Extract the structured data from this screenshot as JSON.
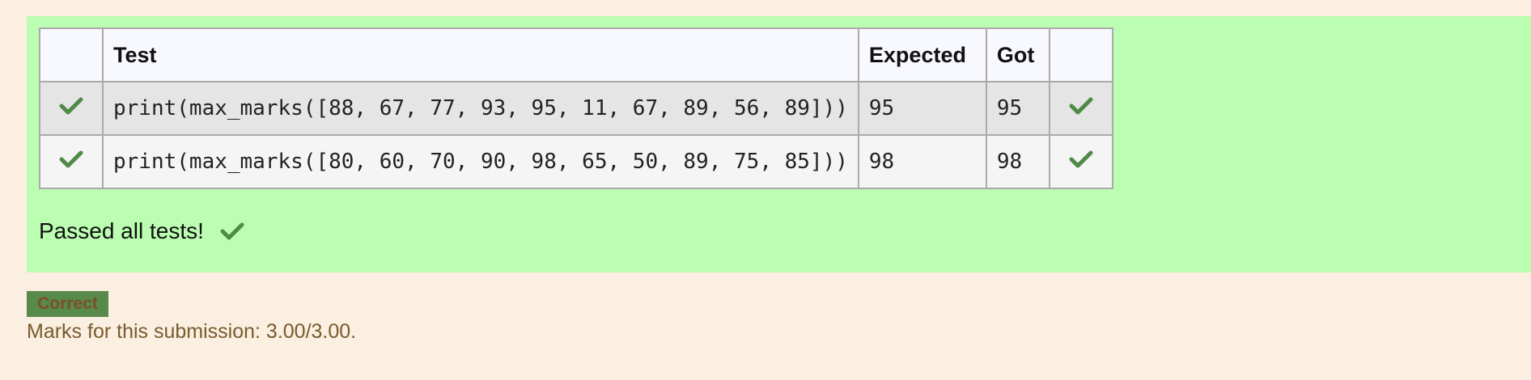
{
  "table": {
    "headers": [
      "",
      "Test",
      "Expected",
      "Got",
      ""
    ],
    "rows": [
      {
        "test": "print(max_marks([88, 67, 77, 93, 95, 11, 67, 89, 56, 89]))",
        "expected": "95",
        "got": "95",
        "status": "pass"
      },
      {
        "test": "print(max_marks([80, 60, 70, 90, 98, 65, 50, 89, 75, 85]))",
        "expected": "98",
        "got": "98",
        "status": "pass"
      }
    ]
  },
  "summary": {
    "passed_text": "Passed all tests!"
  },
  "grade": {
    "badge_label": "Correct",
    "marks_text": "Marks for this submission: 3.00/3.00."
  },
  "colors": {
    "page_bg": "#faefe0",
    "panel_bg": "#bbfdb1",
    "check_green": "#4f8a47",
    "badge_bg": "#588a4b"
  },
  "icons": {
    "status": "check-mark-icon"
  }
}
